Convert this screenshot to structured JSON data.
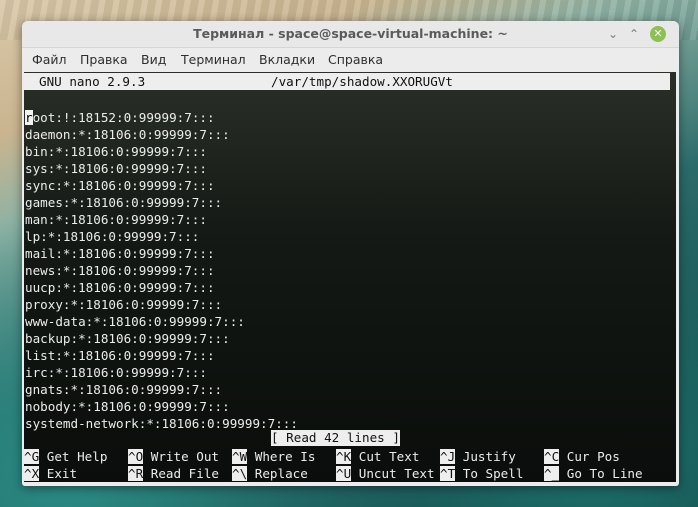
{
  "window": {
    "title": "Терминал - space@space-virtual-machine: ~",
    "min_icon": "minimize-icon",
    "max_icon": "maximize-icon",
    "close_icon": "close-icon",
    "accent_close": "#8cc152"
  },
  "menu": {
    "items": [
      "Файл",
      "Правка",
      "Вид",
      "Терминал",
      "Вкладки",
      "Справка"
    ]
  },
  "nano": {
    "version": "GNU nano 2.9.3",
    "filename": "/var/tmp/shadow.XXORUGVt",
    "cursor_char": "r",
    "lines": [
      "root:!:18152:0:99999:7:::",
      "daemon:*:18106:0:99999:7:::",
      "bin:*:18106:0:99999:7:::",
      "sys:*:18106:0:99999:7:::",
      "sync:*:18106:0:99999:7:::",
      "games:*:18106:0:99999:7:::",
      "man:*:18106:0:99999:7:::",
      "lp:*:18106:0:99999:7:::",
      "mail:*:18106:0:99999:7:::",
      "news:*:18106:0:99999:7:::",
      "uucp:*:18106:0:99999:7:::",
      "proxy:*:18106:0:99999:7:::",
      "www-data:*:18106:0:99999:7:::",
      "backup:*:18106:0:99999:7:::",
      "list:*:18106:0:99999:7:::",
      "irc:*:18106:0:99999:7:::",
      "gnats:*:18106:0:99999:7:::",
      "nobody:*:18106:0:99999:7:::",
      "systemd-network:*:18106:0:99999:7:::"
    ],
    "status": "[ Read 42 lines ]",
    "shortcuts": [
      {
        "key": "^G",
        "label": "Get Help"
      },
      {
        "key": "^O",
        "label": "Write Out"
      },
      {
        "key": "^W",
        "label": "Where Is"
      },
      {
        "key": "^K",
        "label": "Cut Text"
      },
      {
        "key": "^J",
        "label": "Justify"
      },
      {
        "key": "^C",
        "label": "Cur Pos"
      },
      {
        "key": "^X",
        "label": "Exit"
      },
      {
        "key": "^R",
        "label": "Read File"
      },
      {
        "key": "^\\",
        "label": "Replace"
      },
      {
        "key": "^U",
        "label": "Uncut Text"
      },
      {
        "key": "^T",
        "label": "To Spell"
      },
      {
        "key": "^_",
        "label": "Go To Line"
      }
    ]
  }
}
